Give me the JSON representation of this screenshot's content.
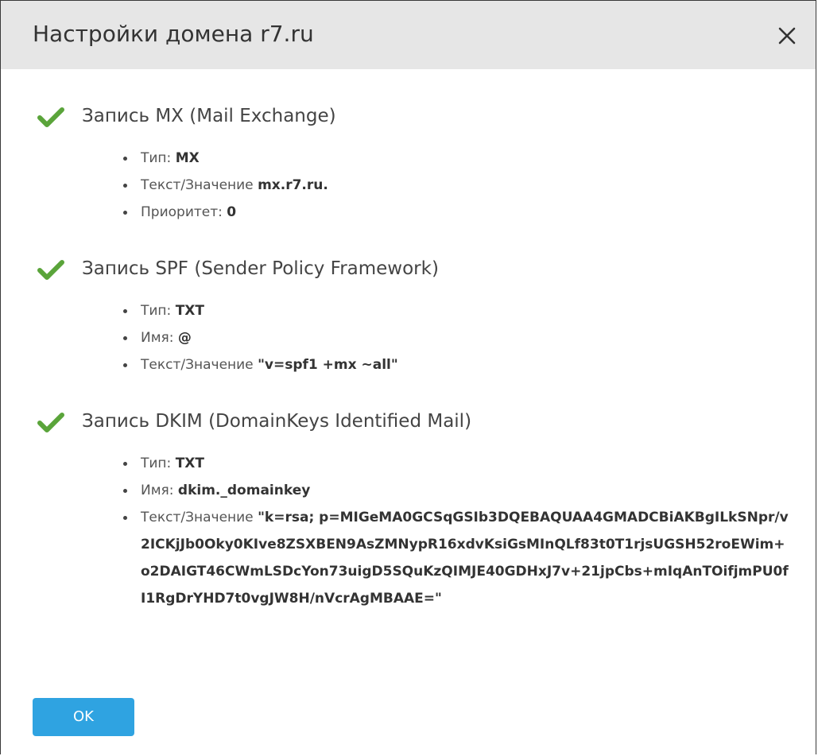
{
  "dialog": {
    "title": "Настройки домена r7.ru",
    "close_icon": "close-icon",
    "ok_label": "OK",
    "colors": {
      "header_bg": "#e6e6e6",
      "check": "#5aa43a",
      "ok_button": "#2fa3e1"
    }
  },
  "sections": [
    {
      "title": "Запись MX (Mail Exchange)",
      "status_icon": "check-icon",
      "fields": [
        {
          "label": "Тип: ",
          "value": "MX"
        },
        {
          "label": "Текст/Значение ",
          "value": "mx.r7.ru."
        },
        {
          "label": "Приоритет: ",
          "value": "0"
        }
      ]
    },
    {
      "title": "Запись SPF (Sender Policy Framework)",
      "status_icon": "check-icon",
      "fields": [
        {
          "label": "Тип: ",
          "value": "TXT"
        },
        {
          "label": "Имя: ",
          "value": "@"
        },
        {
          "label": "Текст/Значение ",
          "value": "\"v=spf1 +mx ~all\""
        }
      ]
    },
    {
      "title": "Запись DKIM (DomainKeys Identified Mail)",
      "status_icon": "check-icon",
      "fields": [
        {
          "label": "Тип: ",
          "value": "TXT"
        },
        {
          "label": "Имя: ",
          "value": "dkim._domainkey"
        },
        {
          "label": "Текст/Значение ",
          "value": "\"k=rsa; p=MIGeMA0GCSqGSIb3DQEBAQUAA4GMADCBiAKBgILkSNpr/v2ICKjJb0Oky0KIve8ZSXBEN9AsZMNypR16xdvKsiGsMInQLf83t0T1rjsUGSH52roEWim+o2DAIGT46CWmLSDcYon73uigD5SQuKzQIMJE40GDHxJ7v+21jpCbs+mIqAnTOifjmPU0fI1RgDrYHD7t0vgJW8H/nVcrAgMBAAE=\""
        }
      ]
    }
  ]
}
